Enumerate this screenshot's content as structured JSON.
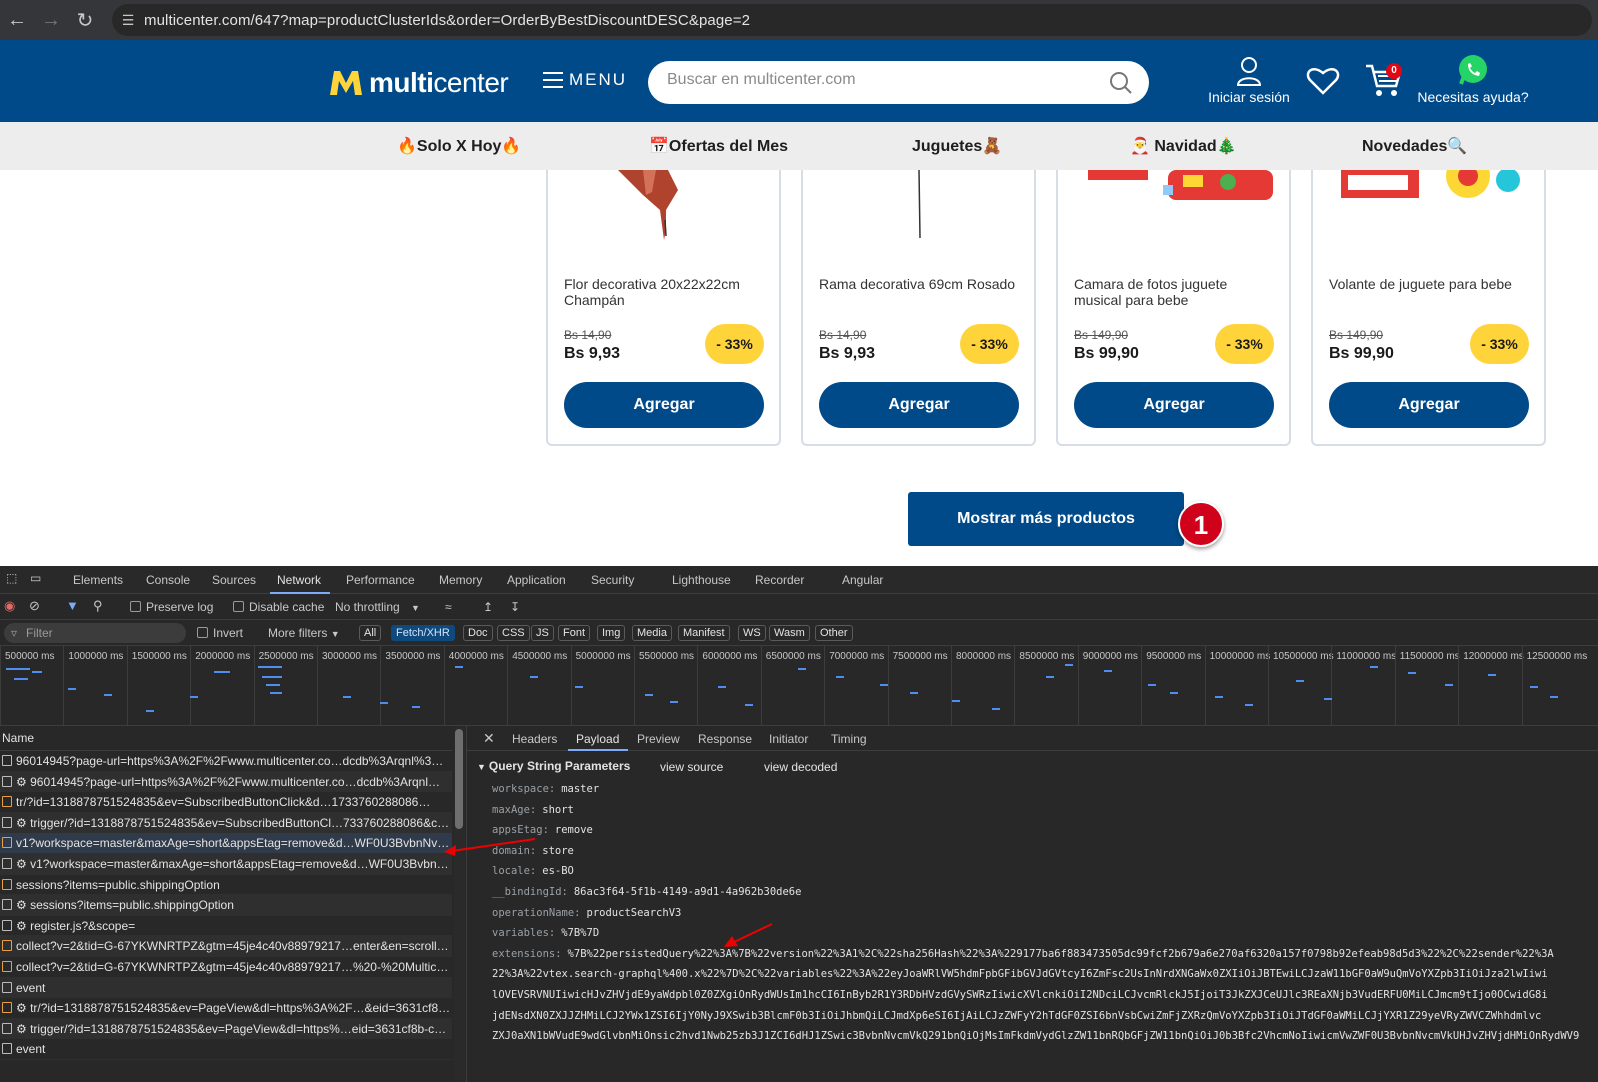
{
  "browser": {
    "url": "multicenter.com/647?map=productClusterIds&order=OrderByBestDiscountDESC&page=2"
  },
  "header": {
    "logo_bold": "multi",
    "logo_light": "center",
    "menu_label": "MENU",
    "search_placeholder": "Buscar en multicenter.com",
    "login_label": "Iniciar sesión",
    "cart_count": "0",
    "help_label": "Necesitas ayuda?",
    "brand_color": "#004a8a"
  },
  "categories": [
    {
      "label": "🔥Solo X Hoy🔥"
    },
    {
      "label": "📅Ofertas del Mes"
    },
    {
      "label": "Juguetes🧸"
    },
    {
      "label": "🎅 Navidad🎄"
    },
    {
      "label": "Novedades🔍"
    }
  ],
  "products": [
    {
      "name": "Flor decorativa 20x22x22cm Champán",
      "old_price": "Bs 14,90",
      "price": "Bs 9,93",
      "discount": "- 33%",
      "button": "Agregar"
    },
    {
      "name": "Rama decorativa 69cm Rosado",
      "old_price": "Bs 14,90",
      "price": "Bs 9,93",
      "discount": "- 33%",
      "button": "Agregar"
    },
    {
      "name": "Camara de fotos juguete musical para bebe",
      "old_price": "Bs 149,90",
      "price": "Bs 99,90",
      "discount": "- 33%",
      "button": "Agregar"
    },
    {
      "name": "Volante de juguete para bebe",
      "old_price": "Bs 149,90",
      "price": "Bs 99,90",
      "discount": "- 33%",
      "button": "Agregar"
    }
  ],
  "more_button": "Mostrar más productos",
  "step_marker": "1",
  "devtools": {
    "tabs": [
      "Elements",
      "Console",
      "Sources",
      "Network",
      "Performance",
      "Memory",
      "Application",
      "Security",
      "Lighthouse",
      "Recorder",
      "Angular"
    ],
    "active_tab": "Network",
    "toolbar": {
      "preserve_log": "Preserve log",
      "disable_cache": "Disable cache",
      "throttling": "No throttling"
    },
    "filter": {
      "placeholder": "Filter",
      "invert": "Invert",
      "more_filters": "More filters"
    },
    "chips": [
      "All",
      "Fetch/XHR",
      "Doc",
      "CSS",
      "JS",
      "Font",
      "Img",
      "Media",
      "Manifest",
      "WS",
      "Wasm",
      "Other"
    ],
    "timeline_ticks": [
      "500000 ms",
      "1000000 ms",
      "1500000 ms",
      "2000000 ms",
      "2500000 ms",
      "3000000 ms",
      "3500000 ms",
      "4000000 ms",
      "4500000 ms",
      "5000000 ms",
      "5500000 ms",
      "6000000 ms",
      "6500000 ms",
      "7000000 ms",
      "7500000 ms",
      "8000000 ms",
      "8500000 ms",
      "9000000 ms",
      "9500000 ms",
      "10000000 ms",
      "10500000 ms",
      "11000000 ms",
      "11500000 ms",
      "12000000 ms",
      "12500000 ms"
    ],
    "name_header": "Name",
    "requests": [
      {
        "name": "96014945?page-url=https%3A%2F%2Fwww.multicenter.co…dcdb%3Arqnl%3…"
      },
      {
        "name": "⚙ 96014945?page-url=https%3A%2F%2Fwww.multicenter.co…dcdb%3Arqnl…"
      },
      {
        "name": "tr/?id=1318878751524835&ev=SubscribedButtonClick&d…1733760288086…"
      },
      {
        "name": "⚙ trigger/?id=1318878751524835&ev=SubscribedButtonCl…733760288086&c…"
      },
      {
        "name": "v1?workspace=master&maxAge=short&appsEtag=remove&d…WF0U3BvbnNv…"
      },
      {
        "name": "⚙ v1?workspace=master&maxAge=short&appsEtag=remove&d…WF0U3Bvbn…"
      },
      {
        "name": "sessions?items=public.shippingOption"
      },
      {
        "name": "⚙ sessions?items=public.shippingOption"
      },
      {
        "name": "⚙ register.js?&scope="
      },
      {
        "name": "collect?v=2&tid=G-67YKWNRTPZ&gtm=45je4c40v88979217…enter&en=scroll…"
      },
      {
        "name": "collect?v=2&tid=G-67YKWNRTPZ&gtm=45je4c40v88979217…%20-%20Multic…"
      },
      {
        "name": "event"
      },
      {
        "name": "⚙ tr/?id=1318878751524835&ev=PageView&dl=https%3A%2F…&eid=3631cf8…"
      },
      {
        "name": "⚙ trigger/?id=1318878751524835&ev=PageView&dl=https%…eid=3631cf8b-c…"
      },
      {
        "name": "event"
      }
    ],
    "detail_tabs": [
      "Headers",
      "Payload",
      "Preview",
      "Response",
      "Initiator",
      "Timing"
    ],
    "active_detail_tab": "Payload",
    "section_title": "Query String Parameters",
    "view_source": "view source",
    "view_decoded": "view decoded",
    "params": [
      {
        "key": "workspace:",
        "value": "master"
      },
      {
        "key": "maxAge:",
        "value": "short"
      },
      {
        "key": "appsEtag:",
        "value": "remove"
      },
      {
        "key": "domain:",
        "value": "store"
      },
      {
        "key": "locale:",
        "value": "es-BO"
      },
      {
        "key": "__bindingId:",
        "value": "86ac3f64-5f1b-4149-a9d1-4a962b30de6e"
      },
      {
        "key": "operationName:",
        "value": "productSearchV3"
      },
      {
        "key": "variables:",
        "value": "%7B%7D"
      },
      {
        "key": "extensions:",
        "value": "%7B%22persistedQuery%22%3A%7B%22version%22%3A1%2C%22sha256Hash%22%3A%229177ba6f883473505dc99fcf2b679a6e270af6320a157f0798b92efeab98d5d3%22%2C%22sender%22%3A"
      }
    ],
    "extension_lines": [
      "22%3A%22vtex.search-graphql%400.x%22%7D%2C%22variables%22%3A%22eyJoaWRlVW5hdmFpbGFibGVJdGVtcyI6ZmFsc2UsInNrdXNGaWx0ZXIiOiJBTEwiLCJzaW11bGF0aW9uQmVoYXZpb3IiOiJza2lwIiwi",
      "lOVEVSRVNUIiwicHJvZHVjdE9yaWdpbl0Z0ZXgiOnRydWUsIm1hcCI6InByb2R1Y3RDbHVzdGVySWRzIiwicXVlcnkiOiI2NDciLCJvcmRlckJ5IjoiT3JkZXJCeUJlc3REaXNjb3VudERFU0MiLCJmcm9tIjo0OCwidG8i",
      "jdENsdXN0ZXJJZHMiLCJ2YWx1ZSI6IjY0NyJ9XSwib3BlcmF0b3IiOiJhbmQiLCJmdXp6eSI6IjAiLCJzZWFyY2hTdGF0ZSI6bnVsbCwiZmFjZXRzQmVoYXZpb3IiOiJTdGF0aWMiLCJjYXR1Z29yeVRyZWVCZWhhdmlvc",
      "ZXJ0aXN1bWVudE9wdGlvbnMiOnsic2hvd1Nwb25zb3J1ZCI6dHJ1ZSwic3BvbnNvcmVkQ291bnQiOjMsImFkdmVydGlzZW11bnRQbGFjZW11bnQiOiJ0b3Bfc2VhcmNoIiwicmVwZWF0U3BvbnNvcmVkUHJvZHVjdHMiOnRydWV9"
    ]
  }
}
